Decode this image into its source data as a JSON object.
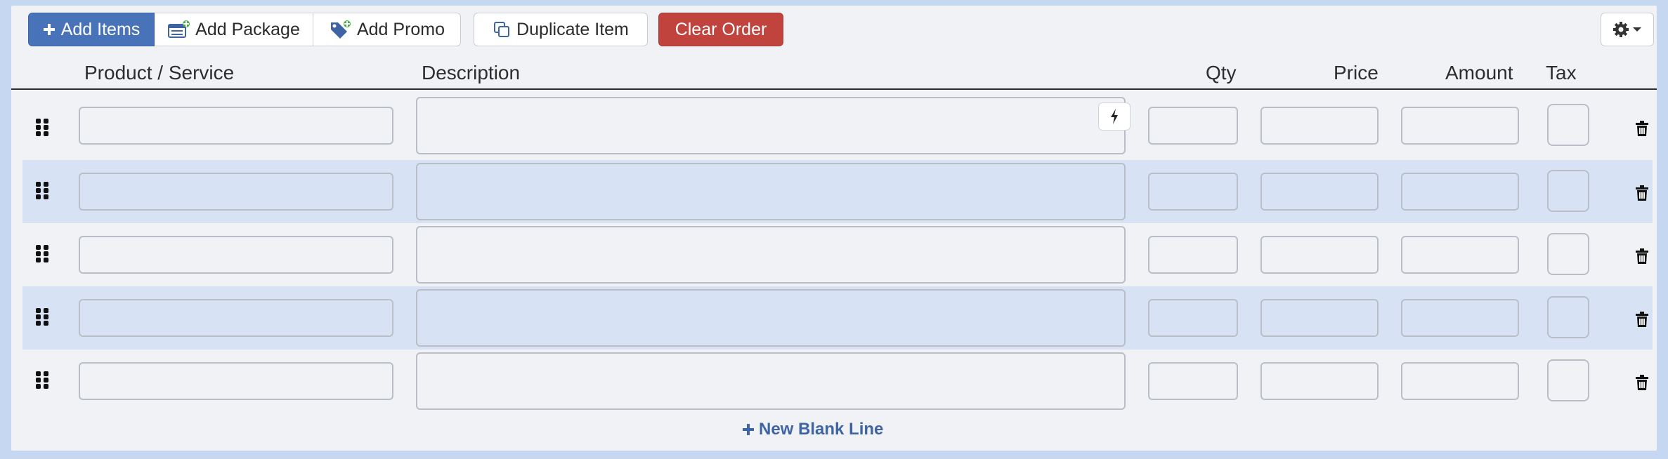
{
  "toolbar": {
    "add_items": "Add Items",
    "add_package": "Add Package",
    "add_promo": "Add Promo",
    "duplicate_item": "Duplicate Item",
    "clear_order": "Clear Order"
  },
  "columns": {
    "product": "Product / Service",
    "description": "Description",
    "qty": "Qty",
    "price": "Price",
    "amount": "Amount",
    "tax": "Tax"
  },
  "rows": [
    {
      "product": "",
      "description": "",
      "qty": "",
      "price": "",
      "amount": ""
    },
    {
      "product": "",
      "description": "",
      "qty": "",
      "price": "",
      "amount": ""
    },
    {
      "product": "",
      "description": "",
      "qty": "",
      "price": "",
      "amount": ""
    },
    {
      "product": "",
      "description": "",
      "qty": "",
      "price": "",
      "amount": ""
    },
    {
      "product": "",
      "description": "",
      "qty": "",
      "price": "",
      "amount": ""
    }
  ],
  "new_line_label": "New Blank Line",
  "icons": {
    "add": "plus-icon",
    "package": "package-icon",
    "promo": "tag-icon",
    "duplicate": "copy-icon",
    "settings": "gear-icon",
    "drag": "drag-handle-icon",
    "delete": "trash-icon",
    "autofill": "bolt-icon"
  },
  "colors": {
    "primary": "#4873b8",
    "danger": "#c0433d",
    "row_alt": "#d7e3f5",
    "link": "#3e64a3"
  }
}
